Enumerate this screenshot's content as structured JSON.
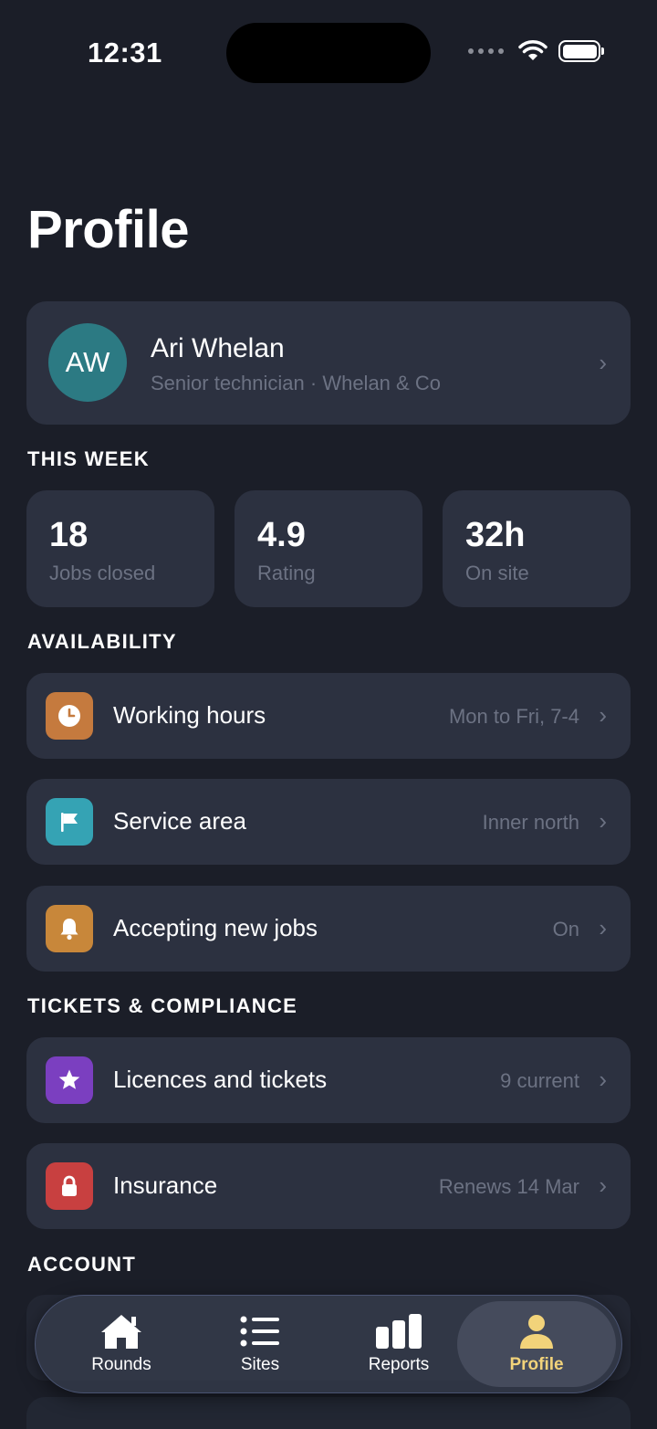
{
  "status_bar": {
    "time": "12:31"
  },
  "page_title": "Profile",
  "profile": {
    "initials": "AW",
    "name": "Ari Whelan",
    "subtitle": "Senior technician · Whelan & Co",
    "avatar_color": "#2c7a83"
  },
  "this_week": {
    "label": "THIS WEEK",
    "stats": [
      {
        "value": "18",
        "label": "Jobs closed"
      },
      {
        "value": "4.9",
        "label": "Rating"
      },
      {
        "value": "32h",
        "label": "On site"
      }
    ]
  },
  "availability": {
    "label": "AVAILABILITY",
    "rows": [
      {
        "icon": "clock-icon",
        "icon_color": "#c57a3e",
        "label": "Working hours",
        "value": "Mon to Fri, 7-4"
      },
      {
        "icon": "flag-icon",
        "icon_color": "#35a3b4",
        "label": "Service area",
        "value": "Inner north"
      },
      {
        "icon": "bell-icon",
        "icon_color": "#c8873a",
        "label": "Accepting new jobs",
        "value": "On"
      }
    ]
  },
  "compliance": {
    "label": "TICKETS & COMPLIANCE",
    "rows": [
      {
        "icon": "star-icon",
        "icon_color": "#7b3fc0",
        "label": "Licences and tickets",
        "value": "9 current"
      },
      {
        "icon": "lock-icon",
        "icon_color": "#c84040",
        "label": "Insurance",
        "value": "Renews 14 Mar"
      }
    ]
  },
  "account": {
    "label": "ACCOUNT"
  },
  "tab_bar": {
    "tabs": [
      {
        "label": "Rounds",
        "icon": "house-icon"
      },
      {
        "label": "Sites",
        "icon": "list-icon"
      },
      {
        "label": "Reports",
        "icon": "bar-chart-icon"
      },
      {
        "label": "Profile",
        "icon": "person-icon",
        "active": true
      }
    ],
    "active_color": "#f2d37a"
  }
}
